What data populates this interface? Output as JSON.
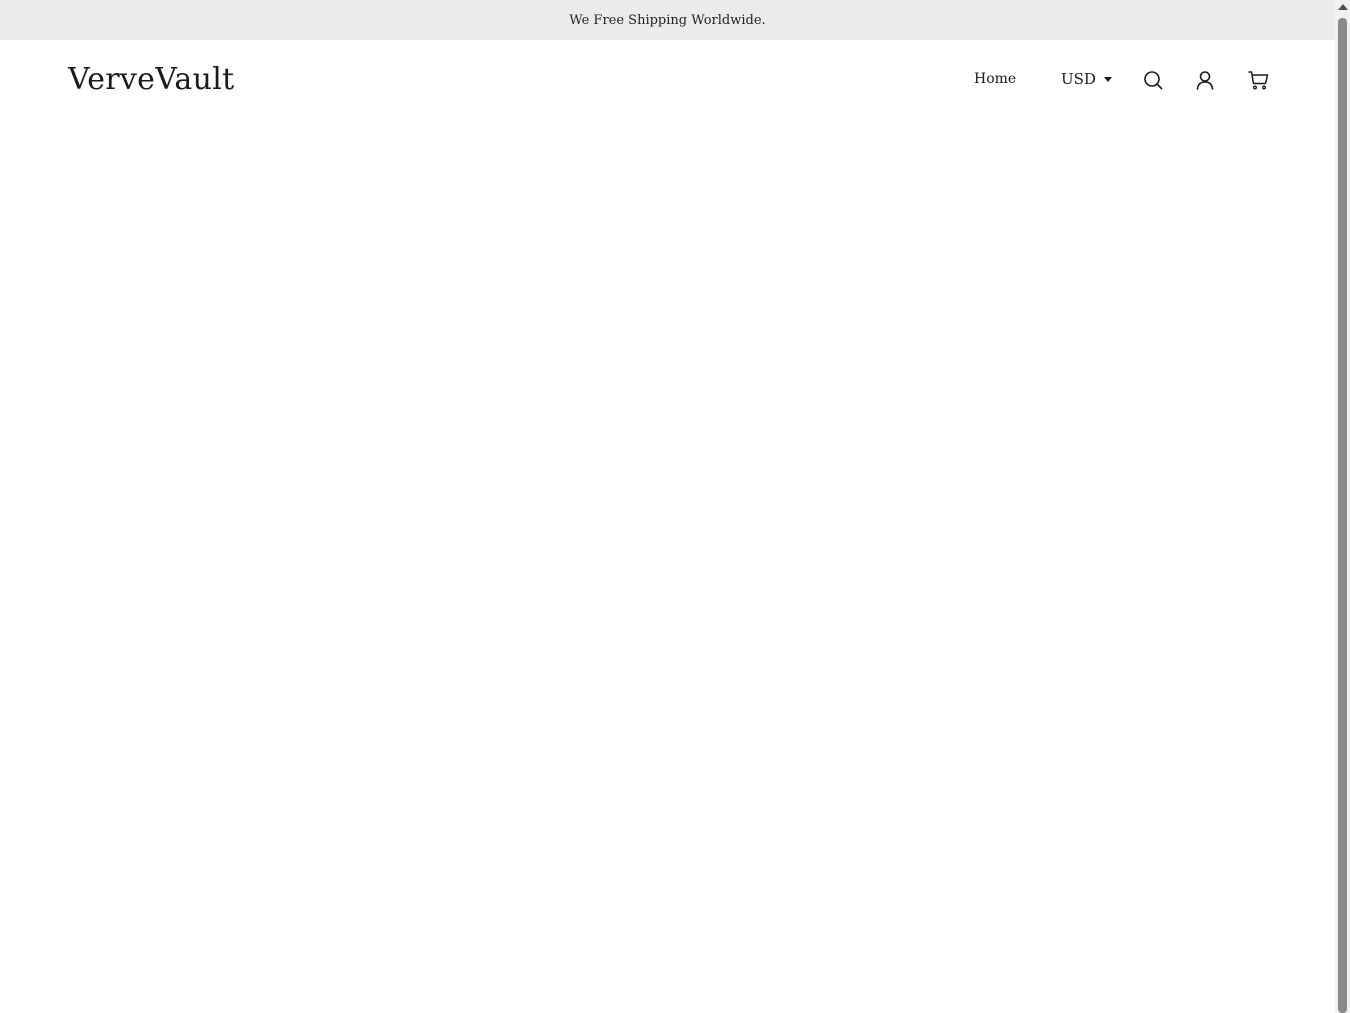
{
  "announcement": {
    "text": "We Free Shipping Worldwide."
  },
  "header": {
    "logo": "VerveVault",
    "nav": {
      "home_label": "Home"
    },
    "currency": {
      "selected": "USD"
    },
    "icons": {
      "search": "search-icon",
      "account": "user-icon",
      "cart": "cart-icon"
    }
  },
  "colors": {
    "announcement_bg": "#ebebeb",
    "text": "#1a1a1a",
    "background": "#ffffff"
  }
}
